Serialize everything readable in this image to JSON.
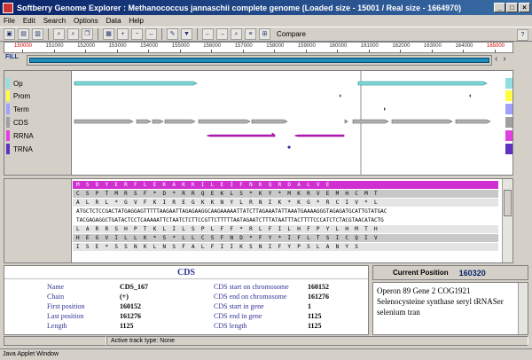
{
  "window": {
    "title": "Softberry Genome Explorer : Methanococcus jannaschii complete genome (Loaded size - 15001 / Real size - 1664970)"
  },
  "menu": [
    "File",
    "Edit",
    "Search",
    "Options",
    "Data",
    "Help"
  ],
  "toolbar": {
    "compare_label": "Compare"
  },
  "ruler": {
    "ticks": [
      "150000",
      "151000",
      "152000",
      "153000",
      "154000",
      "155000",
      "156000",
      "157000",
      "158000",
      "159000",
      "160000",
      "161000",
      "162000",
      "163000",
      "164000",
      "165000"
    ],
    "highlight_color": "#d00000"
  },
  "navigator": {
    "fill_label": "FILL"
  },
  "tracks": [
    {
      "label": "Op",
      "color": "#90e0e0"
    },
    {
      "label": "Prom",
      "color": "#ffff40"
    },
    {
      "label": "Term",
      "color": "#a0a0ff"
    },
    {
      "label": "CDS",
      "color": "#a0a0a0"
    },
    {
      "label": "RRNA",
      "color": "#e040e0"
    },
    {
      "label": "TRNA",
      "color": "#6030c0"
    }
  ],
  "sequence": {
    "rows": [
      "M  S  D  Y  E  R  F  L  E  K  A  K  K  I  L  E  I  F  N  K  Q  R  D  A  L  V  E",
      "C  S  P  T  M  R  S  F  *  D  *  R  R  Q  E  K  L  S  *  K  Y  *  M  K  R  V  E  M  H  C  M  T",
      "A  L  R  L  *  G  V  F  K  I  R  E  G  K  K  N  Y  L  R  N  I  K  *  K  G  *  R  C  I  V  *  L",
      "ATGCTCTCCGACTATGAGGAGTTTTTAAGAATTAGAGAAGGCAAGAAAAATTATCTTAGAAATATTAAATGAAAAGGGTAGAGATGCATTGTATGAC",
      "TACGAGAGGCTGATACTCCTCAAAAATTCTAATCTCTTCCGTTCTTTTTAATAGAATCTTTATAATTTACTTTTCCCATCTCTACGTAACATACTG",
      "L  A  R  R  S  H  P  T  K  L  I  L  S  P  L  F  F  *  R  L  F  I  L  H  F  P  Y  L  H  M  T  H",
      "H  E  G  V  I  L  L  K  *  S  *  L  L  C  S  F  N  D  *  F  Y  *  I  F  L  T  S  I  C  Q  I  V",
      "I  S  E  *  S  S  N  K  L  N  S  F  A  L  F  I  I  K  S  N  I  F  Y  P  S  L  A  N  Y  S"
    ]
  },
  "info": {
    "title": "CDS",
    "left": [
      {
        "key": "Name",
        "value": "CDS_167"
      },
      {
        "key": "Chain",
        "value": "(+)"
      },
      {
        "key": "First position",
        "value": "160152"
      },
      {
        "key": "Last position",
        "value": "161276"
      },
      {
        "key": "Length",
        "value": "1125"
      }
    ],
    "right": [
      {
        "key": "CDS start on chromosome",
        "value": "160152"
      },
      {
        "key": "CDS end on chromosome",
        "value": "161276"
      },
      {
        "key": "CDS start in gene",
        "value": "1"
      },
      {
        "key": "CDS end in gene",
        "value": "1125"
      },
      {
        "key": "CDS length",
        "value": "1125"
      }
    ]
  },
  "current_position": {
    "label": "Current Position",
    "value": "160320"
  },
  "description": "Operon 89 Gene 2 COG1921 Selenocysteine synthase seryl tRNASer selenium tran",
  "status": {
    "active_track": "Active track type: None"
  },
  "applet_label": "Java Applet Window"
}
